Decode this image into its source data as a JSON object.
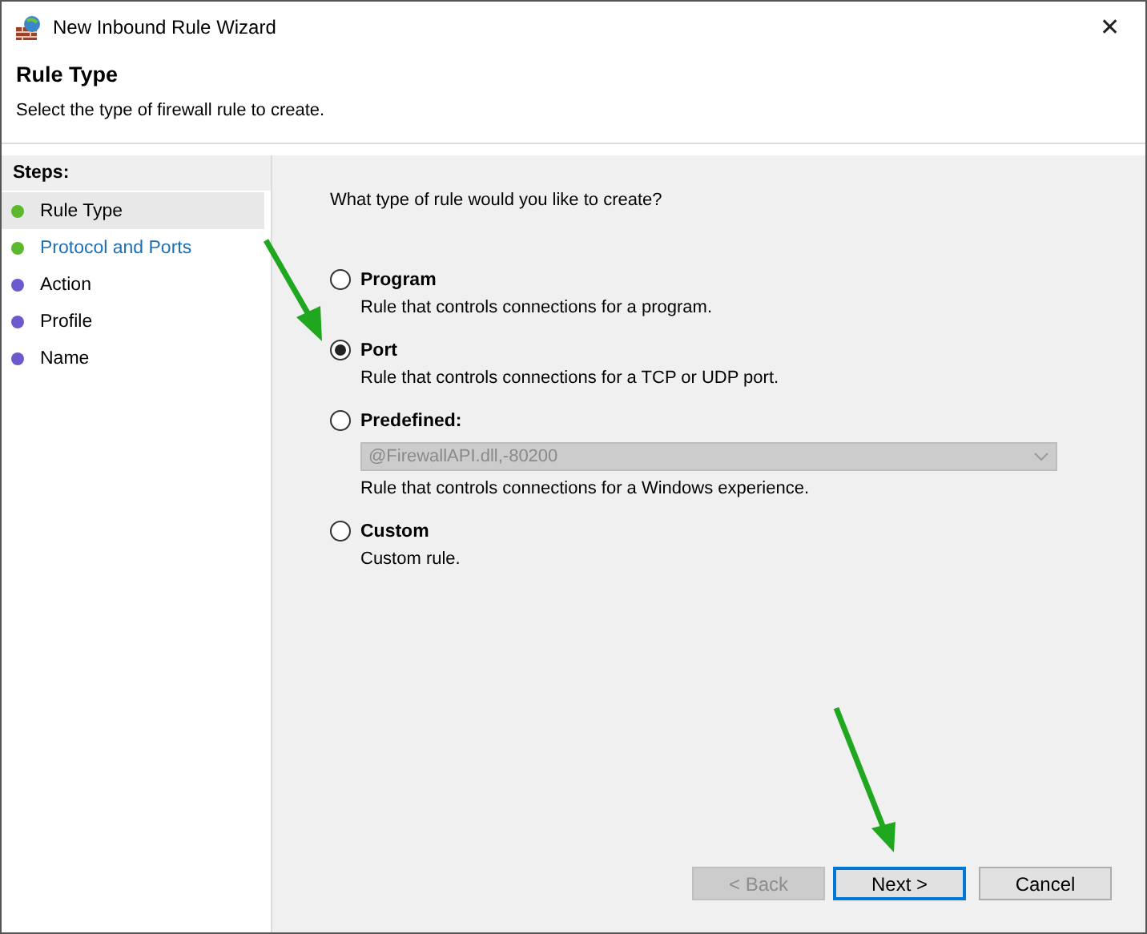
{
  "window": {
    "title": "New Inbound Rule Wizard",
    "close": "✕"
  },
  "header": {
    "title": "Rule Type",
    "subtitle": "Select the type of firewall rule to create."
  },
  "steps": {
    "heading": "Steps:",
    "items": [
      {
        "label": "Rule Type",
        "selected": true,
        "current": false,
        "color": "#5cb82e"
      },
      {
        "label": "Protocol and Ports",
        "selected": false,
        "current": true,
        "color": "#5cb82e"
      },
      {
        "label": "Action",
        "selected": false,
        "current": false,
        "color": "#6a5acd"
      },
      {
        "label": "Profile",
        "selected": false,
        "current": false,
        "color": "#6a5acd"
      },
      {
        "label": "Name",
        "selected": false,
        "current": false,
        "color": "#6a5acd"
      }
    ]
  },
  "question": "What type of rule would you like to create?",
  "options": [
    {
      "kind": "plain",
      "label": "Program",
      "description": "Rule that controls connections for a program.",
      "selected": false
    },
    {
      "kind": "plain",
      "label": "Port",
      "description": "Rule that controls connections for a TCP or UDP port.",
      "selected": true
    },
    {
      "kind": "dropdown",
      "label": "Predefined:",
      "dropdown": {
        "value": "@FirewallAPI.dll,-80200",
        "disabled": true
      },
      "description": "Rule that controls connections for a Windows experience.",
      "selected": false
    },
    {
      "kind": "plain",
      "label": "Custom",
      "description": "Custom rule.",
      "selected": false
    }
  ],
  "buttons": [
    {
      "label": "< Back",
      "disabled": true,
      "focused": false
    },
    {
      "label": "Next >",
      "disabled": false,
      "focused": true
    },
    {
      "label": "Cancel",
      "disabled": false,
      "focused": false
    }
  ]
}
